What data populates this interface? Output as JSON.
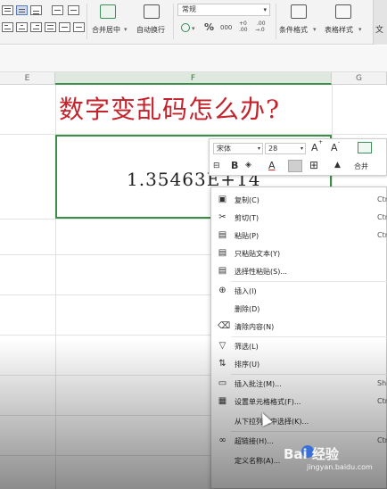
{
  "ribbon": {
    "merge_center": "合并居中",
    "merge_arrow": "▾",
    "wrap_text": "自动换行",
    "number_format": "常规",
    "percent": "%",
    "thousands": "000",
    "dec_increase_top": "+0",
    "dec_increase_bottom": ".00",
    "dec_decrease_top": ".00",
    "dec_decrease_bottom": "→.0",
    "conditional_format": "条件格式",
    "table_style": "表格样式",
    "more": "文"
  },
  "columns": [
    "E",
    "F",
    "G"
  ],
  "sheet": {
    "title": "数字变乱码怎么办?",
    "cell_value": "1.35463E+14"
  },
  "mini_toolbar": {
    "font": "宋体",
    "size": "28",
    "grow_font": "A",
    "shrink_font": "A",
    "bold": "B",
    "font_color": "A",
    "merge": "合并"
  },
  "context_menu": {
    "items": [
      {
        "label": "复制(C)",
        "shortcut": "Ctrl",
        "icon": "copy-icon"
      },
      {
        "label": "剪切(T)",
        "shortcut": "Ctrl",
        "icon": "cut-icon"
      },
      {
        "label": "粘贴(P)",
        "shortcut": "Ctrl",
        "icon": "paste-icon"
      },
      {
        "label": "只粘贴文本(Y)",
        "shortcut": "",
        "icon": "paste-text-icon"
      },
      {
        "label": "选择性粘贴(S)...",
        "shortcut": "",
        "icon": "paste-special-icon"
      },
      {
        "label": "插入(I)",
        "shortcut": "",
        "icon": "insert-icon"
      },
      {
        "label": "删除(D)",
        "shortcut": "",
        "icon": ""
      },
      {
        "label": "清除内容(N)",
        "shortcut": "",
        "icon": "clear-icon"
      },
      {
        "label": "筛选(L)",
        "shortcut": "",
        "icon": "filter-icon"
      },
      {
        "label": "排序(U)",
        "shortcut": "",
        "icon": "sort-icon"
      },
      {
        "label": "插入批注(M)...",
        "shortcut": "Shift",
        "icon": "comment-icon"
      },
      {
        "label": "设置单元格格式(F)...",
        "shortcut": "Ctr",
        "icon": "format-cells-icon"
      },
      {
        "label": "从下拉列表中选择(K)...",
        "shortcut": "",
        "icon": ""
      },
      {
        "label": "超链接(H)...",
        "shortcut": "Ctrl",
        "icon": "link-icon"
      },
      {
        "label": "定义名称(A)...",
        "shortcut": "",
        "icon": ""
      }
    ]
  },
  "watermark": {
    "brand": "Bai 经验",
    "url": "jingyan.baidu.com"
  }
}
